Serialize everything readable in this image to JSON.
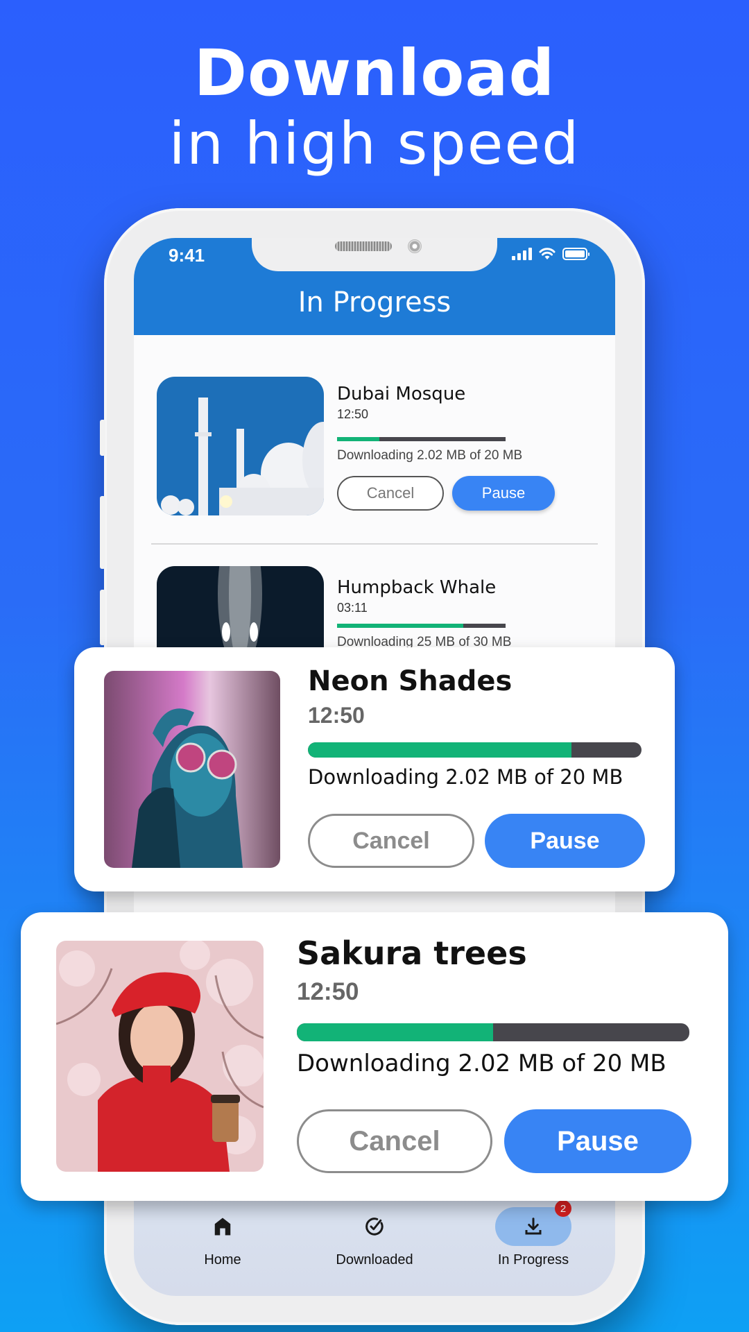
{
  "hero": {
    "title": "Download",
    "subtitle": "in high speed"
  },
  "status_bar": {
    "time": "9:41",
    "icons": [
      "signal-icon",
      "wifi-icon",
      "battery-icon"
    ]
  },
  "app_bar": {
    "title": "In Progress"
  },
  "downloads": [
    {
      "title": "Dubai Mosque",
      "duration": "12:50",
      "progress": 0.25,
      "status": "Downloading 2.02 MB of 20 MB",
      "cancel_label": "Cancel",
      "pause_label": "Pause"
    },
    {
      "title": "Humpback Whale",
      "duration": "03:11",
      "progress": 0.75,
      "status": "Downloading 25 MB of 30 MB"
    }
  ],
  "cards": [
    {
      "title": "Neon Shades",
      "duration": "12:50",
      "progress": 0.79,
      "status": "Downloading 2.02 MB of 20 MB",
      "cancel_label": "Cancel",
      "pause_label": "Pause"
    },
    {
      "title": "Sakura trees",
      "duration": "12:50",
      "progress": 0.5,
      "status": "Downloading 2.02 MB of 20 MB",
      "cancel_label": "Cancel",
      "pause_label": "Pause"
    }
  ],
  "bottom_nav": {
    "items": [
      {
        "label": "Home",
        "icon": "home-icon"
      },
      {
        "label": "Downloaded",
        "icon": "check-circle-icon"
      },
      {
        "label": "In Progress",
        "icon": "download-icon",
        "badge": "2",
        "active": true
      }
    ]
  },
  "colors": {
    "accent": "#3884f4",
    "app_bar": "#1e7bd6",
    "progress_fill": "#12b377",
    "progress_track": "#47464c",
    "badge": "#d32020"
  }
}
